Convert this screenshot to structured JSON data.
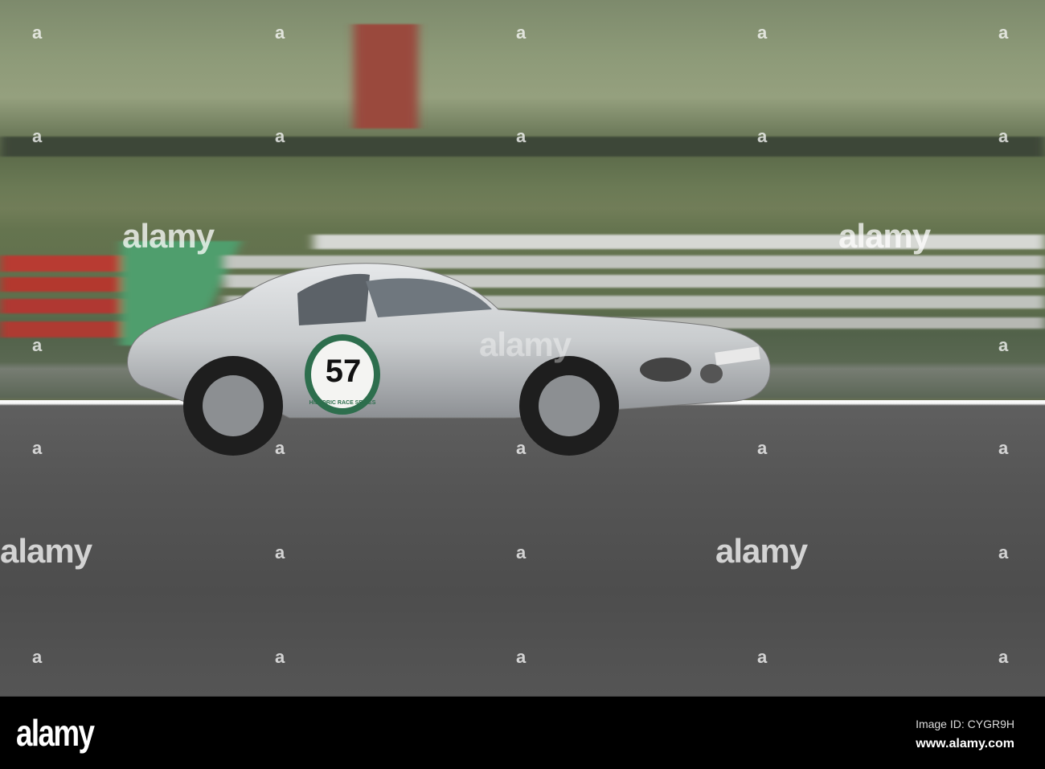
{
  "photo": {
    "car_number": "57",
    "badge_text": "HISTORIC RACE SERIES",
    "watermark": "alamy",
    "watermark_mark": "a"
  },
  "footer": {
    "logo": "alamy",
    "image_id": "Image ID: CYGR9H",
    "website": "www.alamy.com"
  }
}
